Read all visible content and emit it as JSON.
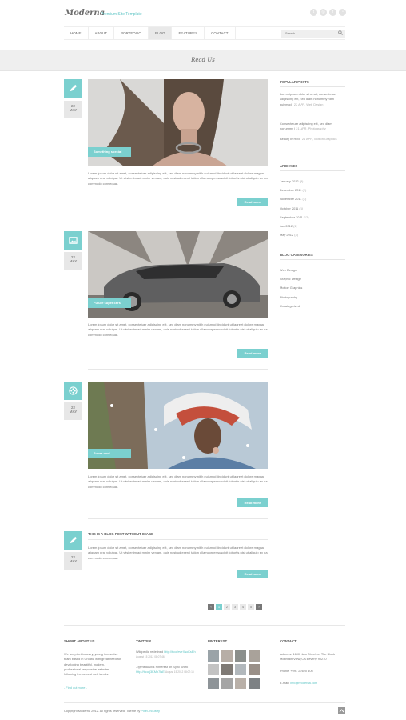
{
  "brand": {
    "logo": "Moderna",
    "tagline": "Premium Site Template"
  },
  "social_icons": [
    "twitter-icon",
    "dribbble-icon",
    "facebook-icon",
    "rss-icon"
  ],
  "nav": {
    "items": [
      "HOME",
      "ABOUT",
      "PORTFOLIO",
      "BLOG",
      "FEATURES",
      "CONTACT"
    ],
    "active": "BLOG"
  },
  "search": {
    "placeholder": "Search"
  },
  "page_title": "Read Us",
  "posts": [
    {
      "day": "22",
      "month": "MAY",
      "label": "Something special",
      "icon": "pencil-icon",
      "text": "Lorem ipsum dolor sit amet, consectetuer adipiscing elit, sed diam nonummy nibh euismod tincidunt ut laoreet dolore magna aliquam erat volutpat. Ut wisi enim ad minim veniam, quis nostrud exerci tation ullamcorper suscipit lobortis nisl ut aliquip ex ea commodo consequat.",
      "read_more": "Read more"
    },
    {
      "day": "22",
      "month": "MAY",
      "label": "Future super cars",
      "icon": "image-icon",
      "text": "Lorem ipsum dolor sit amet, consectetuer adipiscing elit, sed diam nonummy nibh euismod tincidunt ut laoreet dolore magna aliquam erat volutpat. Ut wisi enim ad minim veniam, quis nostrud exerci tation ullamcorper suscipit lobortis nisl ut aliquip ex ea commodo consequat.",
      "read_more": "Read more"
    },
    {
      "day": "22",
      "month": "MAY",
      "label": "Super cool",
      "icon": "film-icon",
      "text": "Lorem ipsum dolor sit amet, consectetuer adipiscing elit, sed diam nonummy nibh euismod tincidunt ut laoreet dolore magna aliquam erat volutpat. Ut wisi enim ad minim veniam, quis nostrud exerci tation ullamcorper suscipit lobortis nisl ut aliquip ex ea commodo consequat.",
      "read_more": "Read more"
    },
    {
      "day": "22",
      "month": "MAY",
      "title": "THIS IS A BLOG POST WITHOUT IMAGE",
      "icon": "pencil-icon",
      "text": "Lorem ipsum dolor sit amet, consectetuer adipiscing elit, sed diam nonummy nibh euismod tincidunt ut laoreet dolore magna aliquam erat volutpat. Ut wisi enim ad minim veniam, quis nostrud exerci tation ullamcorper suscipit lobortis nisl ut aliquip ex ea commodo consequat.",
      "read_more": "Read more"
    }
  ],
  "sidebar": {
    "popular": {
      "title": "POPULAR POSTS",
      "items": [
        {
          "text": "Lorem ipsum dolor sit amet, consectetuer adipiscing elit, sed diam nonummy nibh euismod |",
          "meta": "22 APR, Web Design"
        },
        {
          "text": "Consectetuer adipiscing elit, sed diam nonummy |",
          "meta": "21 APR, Photography"
        },
        {
          "text": "Beauty In Red |",
          "meta": "21 APR, Motion Graphics"
        }
      ]
    },
    "archives": {
      "title": "ARCHIVES",
      "items": [
        {
          "label": "January 2012",
          "count": "(3)"
        },
        {
          "label": "December 2011",
          "count": "(2)"
        },
        {
          "label": "November 2011",
          "count": "(1)"
        },
        {
          "label": "October 2011",
          "count": "(4)"
        },
        {
          "label": "September 2011",
          "count": "(12)"
        },
        {
          "label": "Jun 2012",
          "count": "(1)"
        },
        {
          "label": "May 2012",
          "count": "(3)"
        }
      ]
    },
    "categories": {
      "title": "BLOG CATEGORIES",
      "items": [
        "Web Design",
        "Graphic Design",
        "Motion Graphics",
        "Photography",
        "Uncategorized"
      ]
    }
  },
  "pagination": {
    "prev": "‹",
    "pages": [
      "1",
      "2",
      "3",
      "4",
      "5"
    ],
    "active": "1",
    "next": "›"
  },
  "footer": {
    "about": {
      "title": "SHORT ABOUT US",
      "text": "We are pixel-industry, young innovative team based in Croatia with great need for developing beautiful, modern, professional responsive websites following the newest web trends.",
      "link": "- Find out more -"
    },
    "twitter": {
      "title": "TWITTER",
      "tweets": [
        {
          "text": "Wikipedia redefined",
          "link": "http://t.co/ewrXsoKsEh",
          "date": "August 15 2012 08:07:46"
        },
        {
          "text": "- @medusix's Pinterest on Sync Work",
          "link": "http://t.co/j3KMp7IsE",
          "date": "August 15 2012 08:07:15"
        }
      ]
    },
    "pinterest": {
      "title": "PINTEREST"
    },
    "contact": {
      "title": "CONTACT",
      "address": "Address: 1600 New Street on The Block Mountain View, CA Beverly 90210",
      "phone": "Phone: +091 22620 405",
      "email_label": "E-mail:",
      "email": "info@moderna.com"
    }
  },
  "copyright": {
    "text": "Copyright Moderna 2012. All rights reserved. Theme by",
    "author": "Pixel-Industry"
  },
  "colors": {
    "accent": "#7bd0cf",
    "text": "#777777",
    "bar": "#efefef"
  }
}
